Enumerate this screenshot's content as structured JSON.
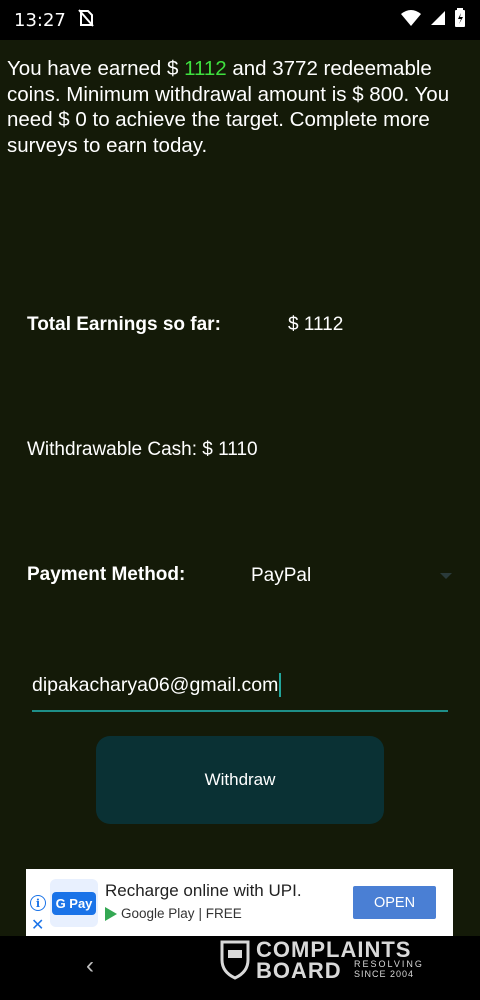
{
  "status_bar": {
    "time": "13:27",
    "icons": [
      "no-sim-icon",
      "wifi-icon",
      "signal-icon",
      "battery-icon"
    ]
  },
  "intro": {
    "part1": "You have earned $ ",
    "earned": "1112",
    "part2": " and 3772 redeemable coins. Minimum withdrawal amount is $ 800. You need $ 0 to achieve the target. Complete more surveys to earn today.",
    "highlight_color": "#3ee03e"
  },
  "earnings": {
    "label": "Total Earnings so far:",
    "value": "$ 1112"
  },
  "cash": {
    "label": "Withdrawable Cash: $ 1110"
  },
  "payment": {
    "label": "Payment Method:",
    "selected": "PayPal"
  },
  "email": {
    "value": "dipakacharya06@gmail.com"
  },
  "withdraw": {
    "label": "Withdraw"
  },
  "ad": {
    "logo_text": "G Pay",
    "title": "Recharge online with UPI.",
    "store": "Google Play",
    "price": "| FREE",
    "cta": "OPEN"
  },
  "watermark": {
    "line1": "COMPLAINTS",
    "line2": "BOARD",
    "small1": "RESOLVING",
    "small2": "SINCE 2004"
  },
  "nav": {
    "back": "‹"
  },
  "colors": {
    "background": "#141a08",
    "accent": "#1e8f88",
    "button": "#0a3134"
  }
}
